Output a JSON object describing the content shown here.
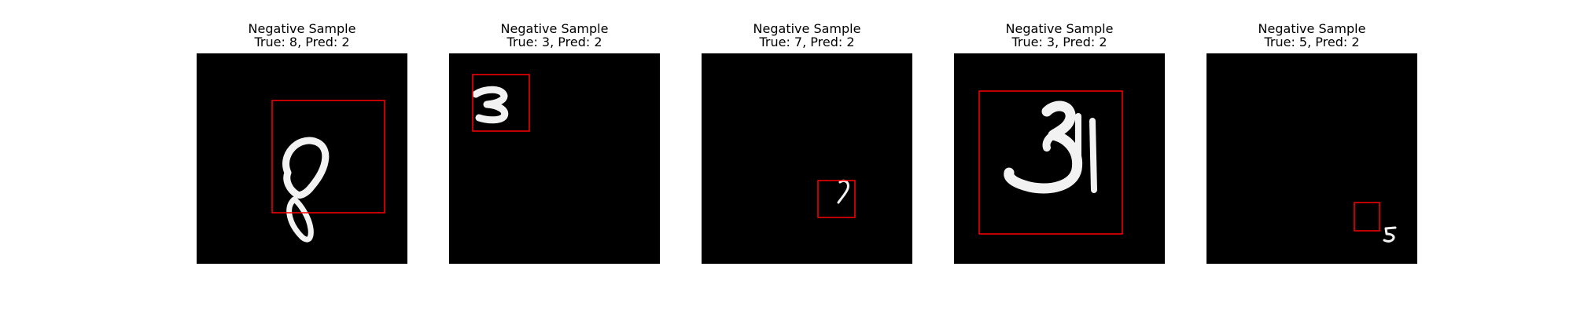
{
  "samples": [
    {
      "title": "Negative Sample",
      "subtitle": "True: 8, Pred: 2",
      "true_label": 8,
      "predicted_label": 2
    },
    {
      "title": "Negative Sample",
      "subtitle": "True: 3, Pred: 2",
      "true_label": 3,
      "predicted_label": 2
    },
    {
      "title": "Negative Sample",
      "subtitle": "True: 7, Pred: 2",
      "true_label": 7,
      "predicted_label": 2
    },
    {
      "title": "Negative Sample",
      "subtitle": "True: 3, Pred: 2",
      "true_label": 3,
      "predicted_label": 2
    },
    {
      "title": "Negative Sample",
      "subtitle": "True: 5, Pred: 2",
      "true_label": 5,
      "predicted_label": 2
    }
  ],
  "colors": {
    "image_background": "#000000",
    "bounding_box": "#ff0000",
    "digit_stroke": "#f2f2f2"
  }
}
